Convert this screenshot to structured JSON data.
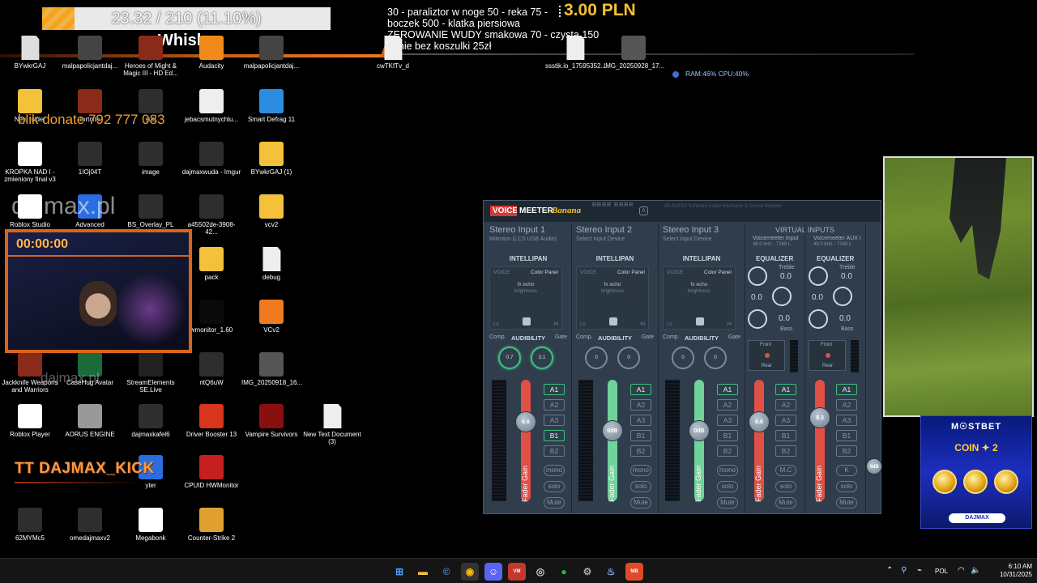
{
  "goal": {
    "text": "23.32 / 210 (11.10%)",
    "progress_percent": 11.1,
    "label": "Whisky"
  },
  "donations": {
    "lines": [
      "30 - paraliztor w noge 50 - reka 75 -",
      " boczek 500 - klatka piersiowa",
      "ZEROWANIE WUDY smakowa 70 - czysta 150",
      "ganie bez koszulki 25zł"
    ],
    "price": "3.00 PLN"
  },
  "overlays": {
    "blik": "blik donate 792 777 083",
    "watermark": "dajmax.pl",
    "watermark2": "dajmax.pl",
    "tt": "TT DAJMAX_KICK",
    "timer": "00:00:00",
    "sysmon": "RAM:46%  CPU:40%"
  },
  "desktop_icons": [
    {
      "label": "BYwkrGAJ",
      "icon": "file-icon"
    },
    {
      "label": "malpapolicjantdaj...",
      "icon": "video-icon"
    },
    {
      "label": "Heroes of Might & Magic III - HD Ed...",
      "icon": "game-icon"
    },
    {
      "label": "Audacity",
      "icon": "audacity-icon"
    },
    {
      "label": "malpapolicjantdaj...",
      "icon": "video-icon"
    },
    {
      "label": "New folder",
      "icon": "folder-icon"
    },
    {
      "label": "fortnite",
      "icon": "game-icon"
    },
    {
      "label": "sub",
      "icon": "image-icon"
    },
    {
      "label": "jebacsmutnychlu...",
      "icon": "media-icon"
    },
    {
      "label": "Smart Defrag 11",
      "icon": "defrag-icon"
    },
    {
      "label": "KROPKA NAD I - zmieniony final v3",
      "icon": "chrome-icon"
    },
    {
      "label": "1IOj04T",
      "icon": "image-icon"
    },
    {
      "label": "image",
      "icon": "image-icon"
    },
    {
      "label": "dajmaxwuda - Imgur",
      "icon": "image-icon"
    },
    {
      "label": "BYwkrGAJ (1)",
      "icon": "folder-icon"
    },
    {
      "label": "Roblox Studio",
      "icon": "roblox-icon"
    },
    {
      "label": "Advanced",
      "icon": "app-icon"
    },
    {
      "label": "BS_Overlay_PL",
      "icon": "image-icon"
    },
    {
      "label": "a45502de-3908-42...",
      "icon": "image-icon"
    },
    {
      "label": "vcv2",
      "icon": "folder-icon"
    },
    {
      "label": "pack",
      "icon": "folder-icon"
    },
    {
      "label": "debug",
      "icon": "document-icon"
    },
    {
      "label": "wmonitor_1.60",
      "icon": "download-icon"
    },
    {
      "label": "VCv2",
      "icon": "vcv-icon"
    },
    {
      "label": "Jackknife Weapons and Warriors",
      "icon": "game-icon"
    },
    {
      "label": "CaseHug Avatar",
      "icon": "casehug-icon"
    },
    {
      "label": "StreamElements SE.Live",
      "icon": "streamelements-icon"
    },
    {
      "label": "ritQ6uW",
      "icon": "image-icon"
    },
    {
      "label": "IMG_20250918_16...",
      "icon": "photo-icon"
    },
    {
      "label": "Roblox Player",
      "icon": "roblox-icon"
    },
    {
      "label": "AORUS ENGINE",
      "icon": "aorus-icon"
    },
    {
      "label": "dajmaxkafel6",
      "icon": "image-icon"
    },
    {
      "label": "Driver Booster 13",
      "icon": "driverbooster-icon"
    },
    {
      "label": "Vampire Survivors",
      "icon": "vampire-icon"
    },
    {
      "label": "New Text Document (3)",
      "icon": "document-icon"
    },
    {
      "label": "yter",
      "icon": "app-icon"
    },
    {
      "label": "CPUID HWMonitor",
      "icon": "hwmonitor-icon"
    },
    {
      "label": "62MYMc5",
      "icon": "image-icon"
    },
    {
      "label": "omedajmaxv2",
      "icon": "image-icon"
    },
    {
      "label": "Megabonk",
      "icon": "megabonk-icon"
    },
    {
      "label": "Counter-Strike 2",
      "icon": "cs2-icon"
    },
    {
      "label": "cwTKfTv_d",
      "icon": "document-icon"
    },
    {
      "label": "ssstik.io_17595352...",
      "icon": "document-icon"
    },
    {
      "label": "IMG_20250928_17...",
      "icon": "photo-icon"
    }
  ],
  "voicemeeter": {
    "logo_voice": "VOICE",
    "logo_meeter": "MEETER",
    "logo_banana": "Banana",
    "rr": "RRRR RRRR",
    "a_badge": "A",
    "info": "VB-AUDIO Software Audio Mechanic & Sound Breeder",
    "strips": [
      {
        "title": "Stereo Input 1",
        "device": "Mikroton (LCS USB Audio)",
        "knob1": "0.7",
        "knob2": "3.1",
        "gain": "6.6",
        "color": "#e05045"
      },
      {
        "title": "Stereo Input 2",
        "device": "Select Input Device",
        "knob1": "0",
        "knob2": "0",
        "gain": "0dB",
        "color": "#6fd39a"
      },
      {
        "title": "Stereo Input 3",
        "device": "Select Input Device",
        "knob1": "0",
        "knob2": "0",
        "gain": "0dB",
        "color": "#6fd39a"
      }
    ],
    "intellipan": "INTELLIPAN",
    "voice": "VOICE",
    "color_panel": "Color Panel",
    "fx_echo": "fx echo",
    "brightness": "brightness",
    "lo": "Lo",
    "hi": "Hi",
    "comp": "Comp.",
    "audibility": "AUDIBILITY",
    "gate": "Gate",
    "fader_gain": "Fader Gain",
    "buses": [
      "A1",
      "A2",
      "A3",
      "B1",
      "B2"
    ],
    "mono": "mono",
    "solo": "solo",
    "mute": "Mute",
    "virtual_title": "VIRTUAL INPUTS",
    "virtual": [
      {
        "name": "Voicemeeter Input",
        "rate": "48.0 kHz - 7168 L",
        "eq_val": "0.0",
        "gain": "6.6",
        "mc": "M.C"
      },
      {
        "name": "Voicemeeter AUX I",
        "rate": "48.0 kHz - 7168 L",
        "eq_val": "0.0",
        "gain": "9.3",
        "mc": "K"
      }
    ],
    "equalizer": "EQUALIZER",
    "treble": "Treble",
    "bass": "Bass",
    "front": "Front",
    "rear": "Rear",
    "edge_gain": "0dB"
  },
  "mostbet": {
    "title": "M☉STBET",
    "sub": "COIN ✦ 2",
    "button": "DAJMAX"
  },
  "taskbar": {
    "lang": "POL",
    "time": "6:10 AM",
    "date": "10/31/2025"
  }
}
